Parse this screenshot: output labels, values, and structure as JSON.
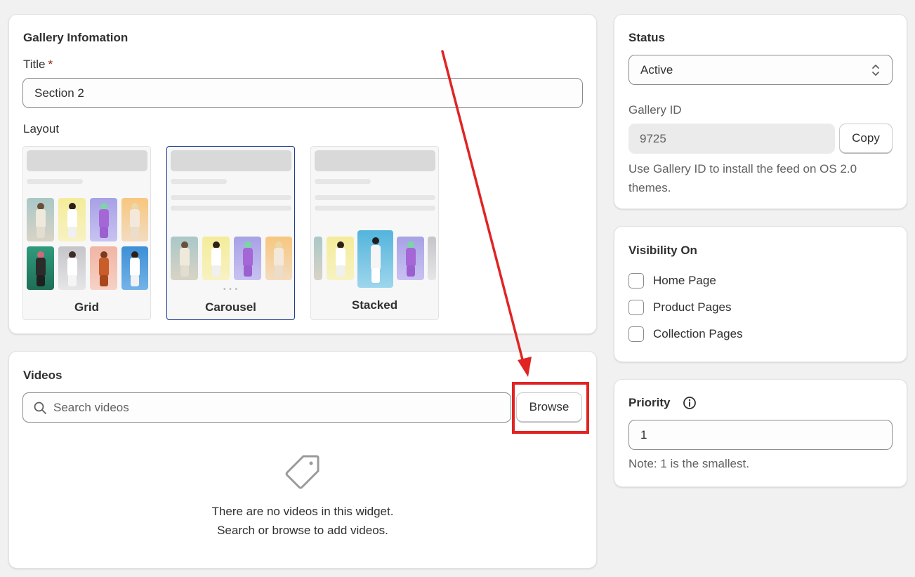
{
  "gallery_info": {
    "title": "Gallery Infomation",
    "title_label": "Title",
    "required_mark": "*",
    "title_value": "Section 2",
    "layout_label": "Layout",
    "layouts": [
      {
        "label": "Grid",
        "selected": false
      },
      {
        "label": "Carousel",
        "selected": true
      },
      {
        "label": "Stacked",
        "selected": false
      }
    ],
    "carousel_dots": "• • •"
  },
  "videos": {
    "title": "Videos",
    "search_placeholder": "Search videos",
    "browse_label": "Browse",
    "empty_line1": "There are no videos in this widget.",
    "empty_line2": "Search or browse to add videos.",
    "empty_icon": "tag-icon"
  },
  "status": {
    "title": "Status",
    "selected": "Active",
    "gallery_id_label": "Gallery ID",
    "gallery_id_value": "9725",
    "copy_label": "Copy",
    "help_text": "Use Gallery ID to install the feed on OS 2.0 themes."
  },
  "visibility": {
    "title": "Visibility On",
    "options": [
      {
        "label": "Home Page",
        "checked": false
      },
      {
        "label": "Product Pages",
        "checked": false
      },
      {
        "label": "Collection Pages",
        "checked": false
      }
    ]
  },
  "priority": {
    "title": "Priority",
    "info_icon": "info-icon",
    "value": "1",
    "note": "Note: 1 is the smallest."
  },
  "annotation": {
    "color": "#e02424"
  }
}
